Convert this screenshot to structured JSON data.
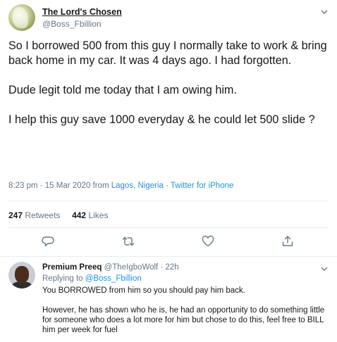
{
  "tweet": {
    "author_name": "The Lord's Chosen",
    "author_handle": "@Boss_Fbillion",
    "text": "So I borrowed 500 from this guy I normally take to work & bring back home in my car. It was 4 days ago. I had forgotten.\n\nDude legit told me today that I am owing him.\n\nI help this guy save 1000 everyday & he could let 500 slide ?",
    "time": "8:23 pm · 15 Mar 2020 from ",
    "location": "Lagos, Nigeria",
    "separator": " · ",
    "source": "Twitter for iPhone",
    "retweets_count": "247",
    "retweets_label": "Retweets",
    "likes_count": "442",
    "likes_label": "Likes"
  },
  "actions": {
    "icons": [
      "reply-icon",
      "retweet-icon",
      "like-icon",
      "share-icon"
    ]
  },
  "reply": {
    "author_name": "Premium Preeq",
    "author_handle": "@TheIgboWolf",
    "time_sep": " · ",
    "time": "22h",
    "replying_prefix": "Replying to ",
    "replying_to": "@Boss_Fbillion",
    "text": "You BORROWED from him so you should pay him back.\n\nHowever, he has shown who he is, he had an opportunity to do something little for someone who does a lot more for him but chose to do this, feel free to BILL him per week for fuel"
  },
  "colors": {
    "text_primary": "#14171a",
    "text_secondary": "#657786",
    "link": "#1b95e0",
    "divider": "#e6ecf0"
  }
}
